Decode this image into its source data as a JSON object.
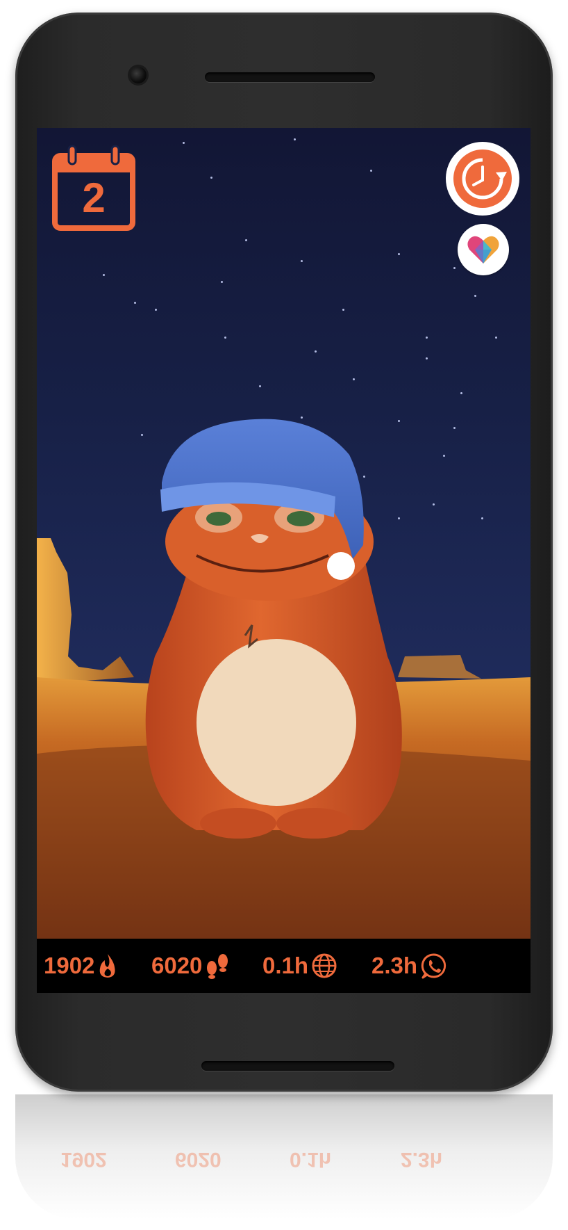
{
  "calendar": {
    "day": "2"
  },
  "stats": {
    "calories": "1902",
    "steps": "6020",
    "browsing": "0.1h",
    "messaging": "2.3h"
  },
  "reflection": {
    "calories": "1902",
    "steps": "6020",
    "browsing": "0.1h",
    "messaging": "2.3h"
  },
  "colors": {
    "accent": "#ef6a3c",
    "sky_top": "#121635",
    "sky_bottom": "#283566",
    "ground": "#c66a23",
    "creature": "#d95a2b",
    "hat": "#4c72c8"
  },
  "icons": {
    "calendar": "calendar-icon",
    "clock": "clock-refresh-icon",
    "heart": "heart-icon",
    "flame": "flame-icon",
    "footsteps": "footsteps-icon",
    "globe": "globe-icon",
    "whatsapp": "whatsapp-icon"
  }
}
